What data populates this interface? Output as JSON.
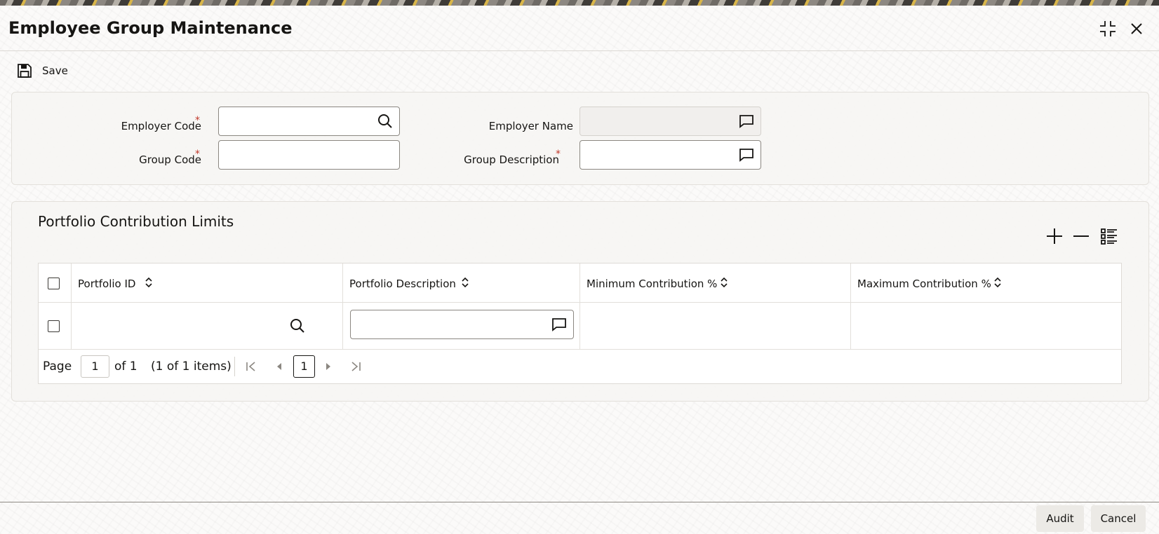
{
  "window": {
    "title": "Employee Group Maintenance"
  },
  "header_icons": {
    "collapse": "collapse-icon",
    "close": "close-icon"
  },
  "toolbar": {
    "save_label": "Save",
    "save_icon": "floppy-disk-icon"
  },
  "form": {
    "employer_code": {
      "label": "Employer Code",
      "required_mark": "*",
      "value": "",
      "icon": "search-icon"
    },
    "employer_name": {
      "label": "Employer Name",
      "value": "",
      "icon": "comment-icon"
    },
    "group_code": {
      "label": "Group Code",
      "required_mark": "*",
      "value": ""
    },
    "group_description": {
      "label": "Group Description",
      "required_mark": "*",
      "value": "",
      "icon": "comment-icon"
    }
  },
  "section": {
    "title": "Portfolio Contribution Limits",
    "tools": [
      "add-icon",
      "remove-icon",
      "list-view-icon"
    ]
  },
  "grid": {
    "columns": [
      "Portfolio ID",
      "Portfolio Description",
      "Minimum Contribution %",
      "Maximum Contribution %"
    ],
    "rows": [
      {
        "portfolio_id": "",
        "portfolio_description": "",
        "min_contribution": "",
        "max_contribution": ""
      }
    ]
  },
  "pagination": {
    "page_label": "Page",
    "current_page": "1",
    "of_label": "of 1",
    "items_summary": "(1 of 1 items)",
    "page_button": "1"
  },
  "footer": {
    "audit_label": "Audit",
    "cancel_label": "Cancel"
  },
  "colors": {
    "accent_required": "#c0392b",
    "text": "#161513",
    "background": "#f7f6f4"
  }
}
